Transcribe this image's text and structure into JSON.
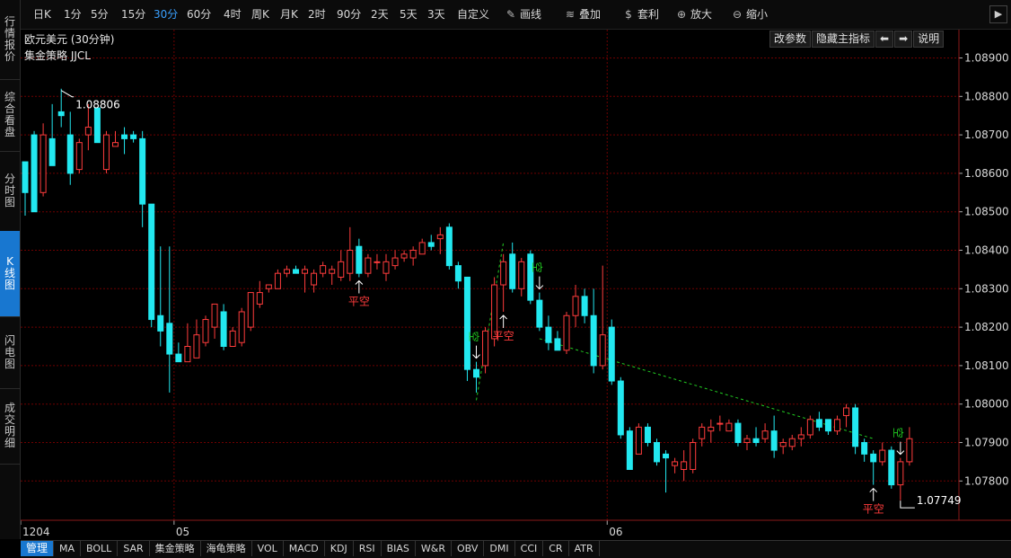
{
  "sidebar": {
    "tabs": [
      {
        "label": "行情报价",
        "active": false
      },
      {
        "label": "综合看盘",
        "active": false
      },
      {
        "label": "分时图",
        "active": false
      },
      {
        "label": "K线图",
        "active": true
      },
      {
        "label": "闪电图",
        "active": false
      },
      {
        "label": "成交明细",
        "active": false
      }
    ]
  },
  "toolbar": {
    "periods": [
      {
        "label": "日K",
        "active": false
      },
      {
        "label": "1分",
        "active": false
      },
      {
        "label": "5分",
        "active": false
      },
      {
        "label": "15分",
        "active": false
      },
      {
        "label": "30分",
        "active": true
      },
      {
        "label": "60分",
        "active": false
      },
      {
        "label": "4时",
        "active": false
      },
      {
        "label": "周K",
        "active": false
      },
      {
        "label": "月K",
        "active": false
      },
      {
        "label": "2时",
        "active": false
      },
      {
        "label": "90分",
        "active": false
      },
      {
        "label": "2天",
        "active": false
      },
      {
        "label": "5天",
        "active": false
      },
      {
        "label": "3天",
        "active": false
      },
      {
        "label": "自定义",
        "active": false
      }
    ],
    "tools": [
      {
        "label": "画线",
        "icon": "pencil-icon"
      },
      {
        "label": "叠加",
        "icon": "layers-icon"
      },
      {
        "label": "套利",
        "icon": "money-bag-icon"
      },
      {
        "label": "放大",
        "icon": "zoom-in-icon"
      },
      {
        "label": "缩小",
        "icon": "zoom-out-icon"
      }
    ]
  },
  "chart_header": {
    "title": "欧元美元 (30分钟)",
    "strategy": "集金策略 JJCL",
    "buttons": [
      "改参数",
      "隐藏主指标",
      "⬅",
      "➡",
      "说明"
    ]
  },
  "indicators": [
    "管理",
    "MA",
    "BOLL",
    "SAR",
    "集金策略",
    "海龟策略",
    "VOL",
    "MACD",
    "KDJ",
    "RSI",
    "BIAS",
    "W&R",
    "OBV",
    "DMI",
    "CCI",
    "CR",
    "ATR"
  ],
  "colors": {
    "up": "#ff3c3c",
    "down": "#22e8f0",
    "grid": "#6e0000",
    "accent": "#1877d0",
    "signal_sell": "#22cc22",
    "signal_close": "#ff3c3c"
  },
  "chart_data": {
    "type": "candlestick",
    "ylim": [
      1.0774,
      1.0891
    ],
    "yticks": [
      "1.08900",
      "1.08800",
      "1.08700",
      "1.08600",
      "1.08500",
      "1.08400",
      "1.08300",
      "1.08200",
      "1.08100",
      "1.08000",
      "1.07900",
      "1.07800"
    ],
    "xlabels": [
      {
        "label": "1204",
        "index": 0
      },
      {
        "label": "05",
        "index": 17
      },
      {
        "label": "06",
        "index": 65
      }
    ],
    "high_label": "1.08806",
    "low_label": "1.07749",
    "candles": [
      [
        1.0863,
        1.0862,
        1.0855,
        1.0849
      ],
      [
        1.087,
        1.0871,
        1.085,
        1.085
      ],
      [
        1.0855,
        1.0873,
        1.087,
        1.0854
      ],
      [
        1.0869,
        1.0878,
        1.0862,
        1.0862
      ],
      [
        1.0876,
        1.0882,
        1.0875,
        1.0872
      ],
      [
        1.087,
        1.0876,
        1.086,
        1.0857
      ],
      [
        1.0861,
        1.0869,
        1.0868,
        1.086
      ],
      [
        1.087,
        1.0878,
        1.0872,
        1.0866
      ],
      [
        1.0877,
        1.0877,
        1.0868,
        1.0868
      ],
      [
        1.0861,
        1.0871,
        1.087,
        1.086
      ],
      [
        1.0867,
        1.0871,
        1.0868,
        1.0867
      ],
      [
        1.087,
        1.0872,
        1.0869,
        1.0865
      ],
      [
        1.087,
        1.0871,
        1.0869,
        1.0868
      ],
      [
        1.0869,
        1.0871,
        1.0852,
        1.0846
      ],
      [
        1.0852,
        1.0852,
        1.0822,
        1.082
      ],
      [
        1.0823,
        1.0841,
        1.0819,
        1.0815
      ],
      [
        1.0821,
        1.0841,
        1.0813,
        1.0803
      ],
      [
        1.0813,
        1.0816,
        1.0811,
        1.0811
      ],
      [
        1.0811,
        1.0821,
        1.0815,
        1.0811
      ],
      [
        1.0812,
        1.0822,
        1.0818,
        1.0812
      ],
      [
        1.0816,
        1.0823,
        1.0822,
        1.0815
      ],
      [
        1.082,
        1.0825,
        1.0826,
        1.0817
      ],
      [
        1.0824,
        1.0826,
        1.0815,
        1.0814
      ],
      [
        1.0815,
        1.082,
        1.0819,
        1.0815
      ],
      [
        1.0816,
        1.0825,
        1.0824,
        1.0815
      ],
      [
        1.082,
        1.0823,
        1.0829,
        1.0819
      ],
      [
        1.0826,
        1.0832,
        1.0829,
        1.0825
      ],
      [
        1.083,
        1.0831,
        1.0831,
        1.0829
      ],
      [
        1.083,
        1.0835,
        1.0834,
        1.083
      ],
      [
        1.0834,
        1.0836,
        1.0835,
        1.0833
      ],
      [
        1.0835,
        1.0836,
        1.0834,
        1.0834
      ],
      [
        1.0834,
        1.0836,
        1.0835,
        1.0829
      ],
      [
        1.0831,
        1.0835,
        1.0834,
        1.0829
      ],
      [
        1.0834,
        1.0837,
        1.0836,
        1.0833
      ],
      [
        1.0834,
        1.0836,
        1.0835,
        1.0831
      ],
      [
        1.0833,
        1.084,
        1.0837,
        1.0832
      ],
      [
        1.0834,
        1.0846,
        1.084,
        1.0832
      ],
      [
        1.0841,
        1.0843,
        1.0834,
        1.0833
      ],
      [
        1.0834,
        1.0839,
        1.0838,
        1.0833
      ],
      [
        1.0837,
        1.0839,
        1.0837,
        1.0835
      ],
      [
        1.0834,
        1.0839,
        1.0837,
        1.0832
      ],
      [
        1.0836,
        1.084,
        1.0838,
        1.0835
      ],
      [
        1.0838,
        1.084,
        1.0839,
        1.0837
      ],
      [
        1.0838,
        1.0841,
        1.084,
        1.0836
      ],
      [
        1.0839,
        1.0843,
        1.0842,
        1.0839
      ],
      [
        1.0842,
        1.0844,
        1.0841,
        1.084
      ],
      [
        1.0843,
        1.0846,
        1.0844,
        1.0839
      ],
      [
        1.0846,
        1.0847,
        1.0836,
        1.0835
      ],
      [
        1.0836,
        1.0837,
        1.0832,
        1.083
      ],
      [
        1.0833,
        1.0833,
        1.0809,
        1.0806
      ],
      [
        1.0809,
        1.0811,
        1.0807,
        1.0803
      ],
      [
        1.081,
        1.082,
        1.0819,
        1.0808
      ],
      [
        1.0817,
        1.0833,
        1.0831,
        1.0815
      ],
      [
        1.0831,
        1.0839,
        1.0837,
        1.0824
      ],
      [
        1.0839,
        1.0842,
        1.083,
        1.0829
      ],
      [
        1.083,
        1.0838,
        1.0837,
        1.0828
      ],
      [
        1.0839,
        1.084,
        1.0827,
        1.0826
      ],
      [
        1.0827,
        1.0829,
        1.082,
        1.0819
      ],
      [
        1.082,
        1.0823,
        1.0816,
        1.0814
      ],
      [
        1.0817,
        1.0819,
        1.0814,
        1.0814
      ],
      [
        1.0814,
        1.0824,
        1.0823,
        1.0813
      ],
      [
        1.0823,
        1.0831,
        1.0828,
        1.082
      ],
      [
        1.0828,
        1.083,
        1.0823,
        1.0821
      ],
      [
        1.0823,
        1.083,
        1.081,
        1.0808
      ],
      [
        1.081,
        1.0836,
        1.0818,
        1.0809
      ],
      [
        1.082,
        1.0822,
        1.0806,
        1.0805
      ],
      [
        1.0806,
        1.0807,
        1.0792,
        1.0791
      ],
      [
        1.0793,
        1.0794,
        1.0783,
        1.0783
      ],
      [
        1.0787,
        1.0795,
        1.0794,
        1.0787
      ],
      [
        1.0794,
        1.0795,
        1.079,
        1.0789
      ],
      [
        1.079,
        1.0791,
        1.0785,
        1.0784
      ],
      [
        1.0787,
        1.0788,
        1.0786,
        1.0777
      ],
      [
        1.0784,
        1.0786,
        1.0785,
        1.0782
      ],
      [
        1.0783,
        1.0788,
        1.0785,
        1.078
      ],
      [
        1.0783,
        1.0791,
        1.079,
        1.0782
      ],
      [
        1.0791,
        1.0795,
        1.0794,
        1.0789
      ],
      [
        1.0793,
        1.0796,
        1.0794,
        1.079
      ],
      [
        1.0795,
        1.0797,
        1.0795,
        1.0793
      ],
      [
        1.0793,
        1.0796,
        1.0795,
        1.0793
      ],
      [
        1.0795,
        1.0796,
        1.079,
        1.0789
      ],
      [
        1.079,
        1.0792,
        1.0791,
        1.0788
      ],
      [
        1.0791,
        1.0794,
        1.079,
        1.0789
      ],
      [
        1.0791,
        1.0795,
        1.0793,
        1.079
      ],
      [
        1.0793,
        1.0797,
        1.0788,
        1.0786
      ],
      [
        1.0789,
        1.0791,
        1.079,
        1.0787
      ],
      [
        1.0789,
        1.0792,
        1.0791,
        1.0788
      ],
      [
        1.0791,
        1.0794,
        1.0792,
        1.0789
      ],
      [
        1.0792,
        1.0797,
        1.0796,
        1.0791
      ],
      [
        1.0796,
        1.0798,
        1.0794,
        1.0793
      ],
      [
        1.0796,
        1.0796,
        1.0793,
        1.0792
      ],
      [
        1.0793,
        1.0797,
        1.0796,
        1.0792
      ],
      [
        1.0797,
        1.08,
        1.0799,
        1.0794
      ],
      [
        1.0799,
        1.08,
        1.0789,
        1.0787
      ],
      [
        1.079,
        1.0791,
        1.0787,
        1.0785
      ],
      [
        1.0787,
        1.0788,
        1.0785,
        1.0779
      ],
      [
        1.0785,
        1.079,
        1.0788,
        1.0784
      ],
      [
        1.0788,
        1.0789,
        1.0779,
        1.0778
      ],
      [
        1.0779,
        1.0786,
        1.0785,
        1.0775
      ],
      [
        1.0785,
        1.0794,
        1.0791,
        1.0784
      ]
    ],
    "signals": [
      {
        "text": "平空",
        "index": 37,
        "side": "below",
        "color": "#ff3c3c"
      },
      {
        "text": "空",
        "index": 50,
        "side": "above",
        "color": "#22cc22"
      },
      {
        "text": "平空",
        "index": 53,
        "side": "below",
        "color": "#ff3c3c"
      },
      {
        "text": "空",
        "index": 57,
        "side": "above",
        "color": "#22cc22"
      },
      {
        "text": "平空",
        "index": 94,
        "side": "below",
        "color": "#ff3c3c"
      },
      {
        "text": "空",
        "index": 97,
        "side": "above",
        "color": "#22cc22"
      }
    ]
  }
}
